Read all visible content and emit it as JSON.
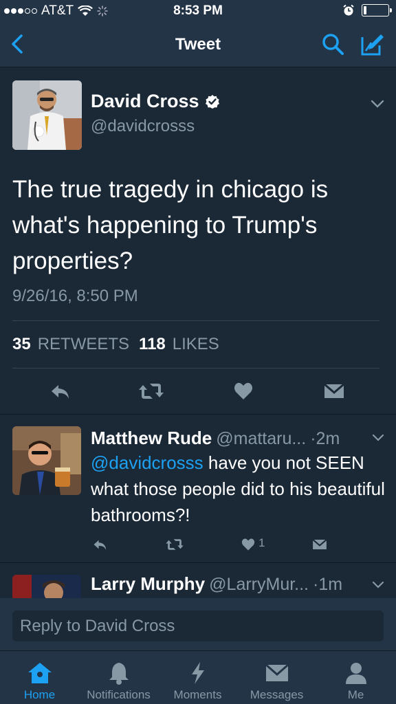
{
  "status_bar": {
    "carrier": "AT&T",
    "time": "8:53 PM"
  },
  "nav": {
    "title": "Tweet"
  },
  "tweet": {
    "author_name": "David Cross",
    "author_handle": "@davidcrosss",
    "text": "The true tragedy in chicago is what's happening to Trump's properties?",
    "date": "9/26/16, 8:50 PM",
    "retweets_count": "35",
    "retweets_label": "RETWEETS",
    "likes_count": "118",
    "likes_label": "LIKES"
  },
  "replies": [
    {
      "name": "Matthew Rude",
      "handle": "@mattaru...",
      "time": "·2m",
      "mention": "@davidcrosss",
      "text": " have you not SEEN what those people did to his beautiful bathrooms?!",
      "like_count": "1"
    },
    {
      "name": "Larry Murphy",
      "handle": "@LarryMur...",
      "time": "·1m"
    }
  ],
  "reply_bar": {
    "placeholder": "Reply to David Cross"
  },
  "tabs": [
    {
      "label": "Home",
      "icon": "home-icon"
    },
    {
      "label": "Notifications",
      "icon": "bell-icon"
    },
    {
      "label": "Moments",
      "icon": "lightning-icon"
    },
    {
      "label": "Messages",
      "icon": "envelope-icon"
    },
    {
      "label": "Me",
      "icon": "person-icon"
    }
  ],
  "colors": {
    "background": "#1b2836",
    "bar": "#243447",
    "accent": "#1da1f2",
    "muted": "#8899a6"
  }
}
